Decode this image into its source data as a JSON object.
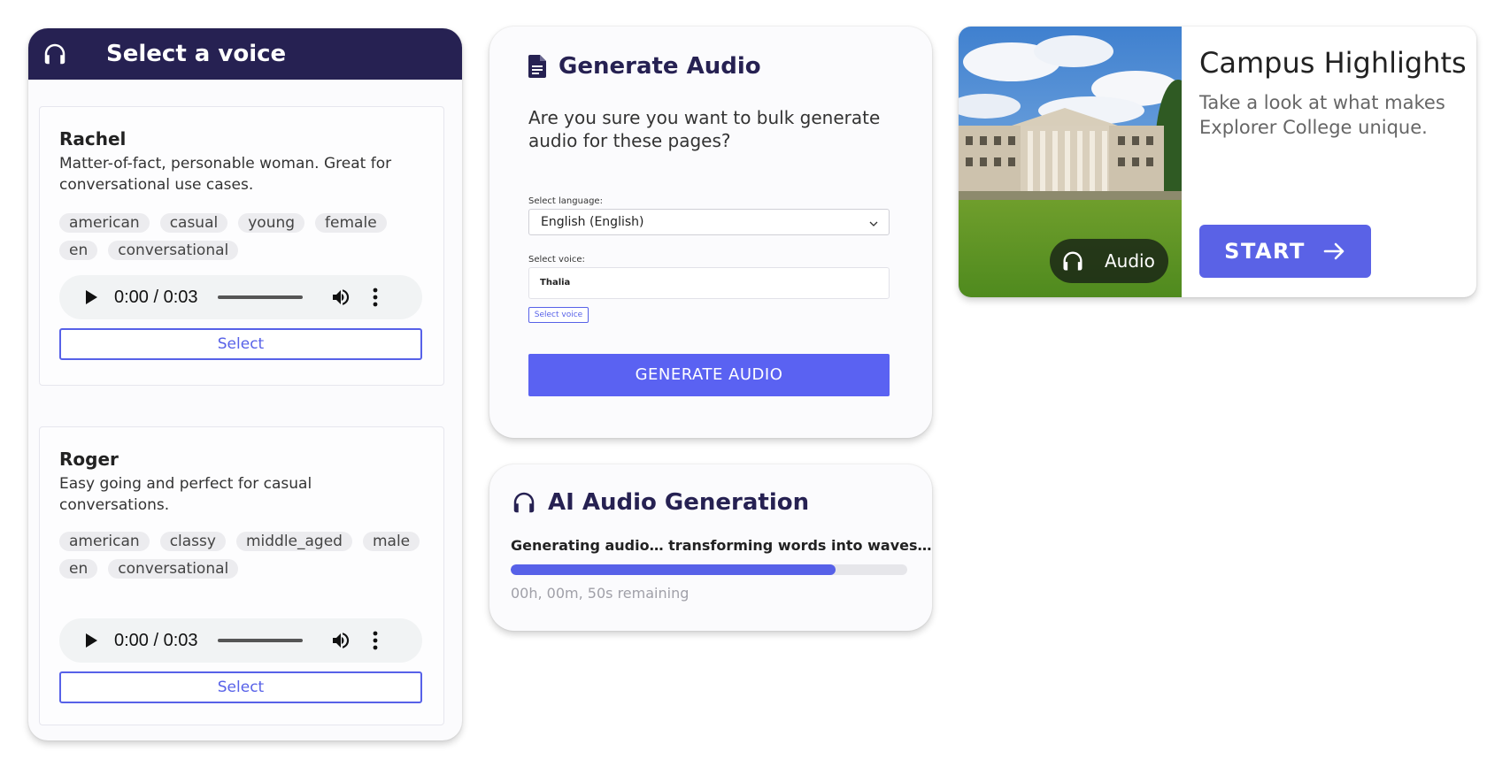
{
  "voice_panel": {
    "title": "Select a voice",
    "voices": [
      {
        "name": "Rachel",
        "description": "Matter-of-fact, personable woman. Great for conversational use cases.",
        "tags": [
          "american",
          "casual",
          "young",
          "female",
          "en",
          "conversational"
        ],
        "player_time": "0:00 / 0:03",
        "select_label": "Select"
      },
      {
        "name": "Roger",
        "description": "Easy going and perfect for casual conversations.",
        "tags": [
          "american",
          "classy",
          "middle_aged",
          "male",
          "en",
          "conversational"
        ],
        "player_time": "0:00 / 0:03",
        "select_label": "Select"
      }
    ]
  },
  "generate_card": {
    "title": "Generate Audio",
    "question": "Are you sure you want to bulk generate audio for these pages?",
    "language_label": "Select language:",
    "language_value": "English (English)",
    "voice_label": "Select voice:",
    "voice_value": "Thalia",
    "select_voice_button": "Select voice",
    "generate_button": "GENERATE AUDIO"
  },
  "ai_card": {
    "title": "AI Audio Generation",
    "status": "Generating audio… transforming words into waves…",
    "remaining": "00h, 00m, 50s remaining",
    "progress_percent": 82
  },
  "campus_card": {
    "title": "Campus Highlights",
    "subtitle": "Take a look at what makes Explorer College unique.",
    "audio_label": "Audio",
    "start_label": "START"
  },
  "colors": {
    "header_navy": "#262152",
    "accent": "#5761e8"
  }
}
